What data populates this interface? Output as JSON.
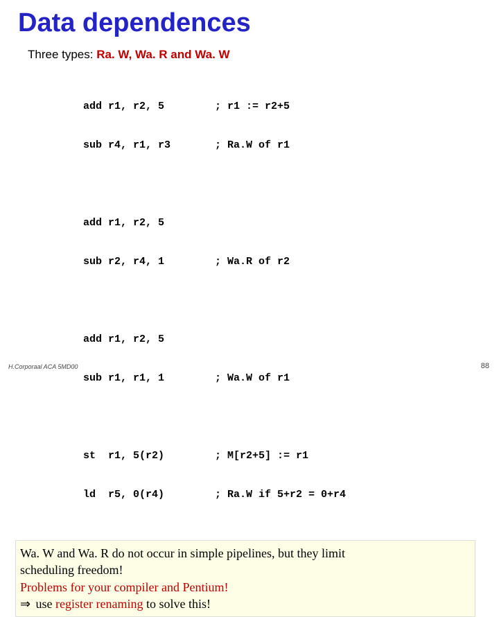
{
  "title": "Data dependences",
  "subtitle_prefix": "Three types: ",
  "subtitle_types": "Ra. W, Wa. R and Wa. W",
  "code": [
    [
      {
        "left": "add r1, r2, 5",
        "right": "; r1 := r2+5"
      },
      {
        "left": "sub r4, r1, r3",
        "right": "; Ra.W of r1"
      }
    ],
    [
      {
        "left": "add r1, r2, 5",
        "right": ""
      },
      {
        "left": "sub r2, r4, 1",
        "right": "; Wa.R of r2"
      }
    ],
    [
      {
        "left": "add r1, r2, 5",
        "right": ""
      },
      {
        "left": "sub r1, r1, 1",
        "right": "; Wa.W of r1"
      }
    ],
    [
      {
        "left": "st  r1, 5(r2)",
        "right": "; M[r2+5] := r1"
      },
      {
        "left": "ld  r5, 0(r4)",
        "right": "; Ra.W if 5+r2 = 0+r4"
      }
    ]
  ],
  "notes": {
    "line1": "Wa. W and Wa. R do not occur in simple pipelines, but they limit",
    "line2": " scheduling freedom!",
    "line3": "Problems for your compiler and Pentium!",
    "line4a": " use ",
    "line4b": "register renaming",
    "line4c": " to solve this!",
    "arrow": "⇒"
  },
  "footer_left": "H.Corporaal  ACA 5MD00",
  "footer_right": "88"
}
